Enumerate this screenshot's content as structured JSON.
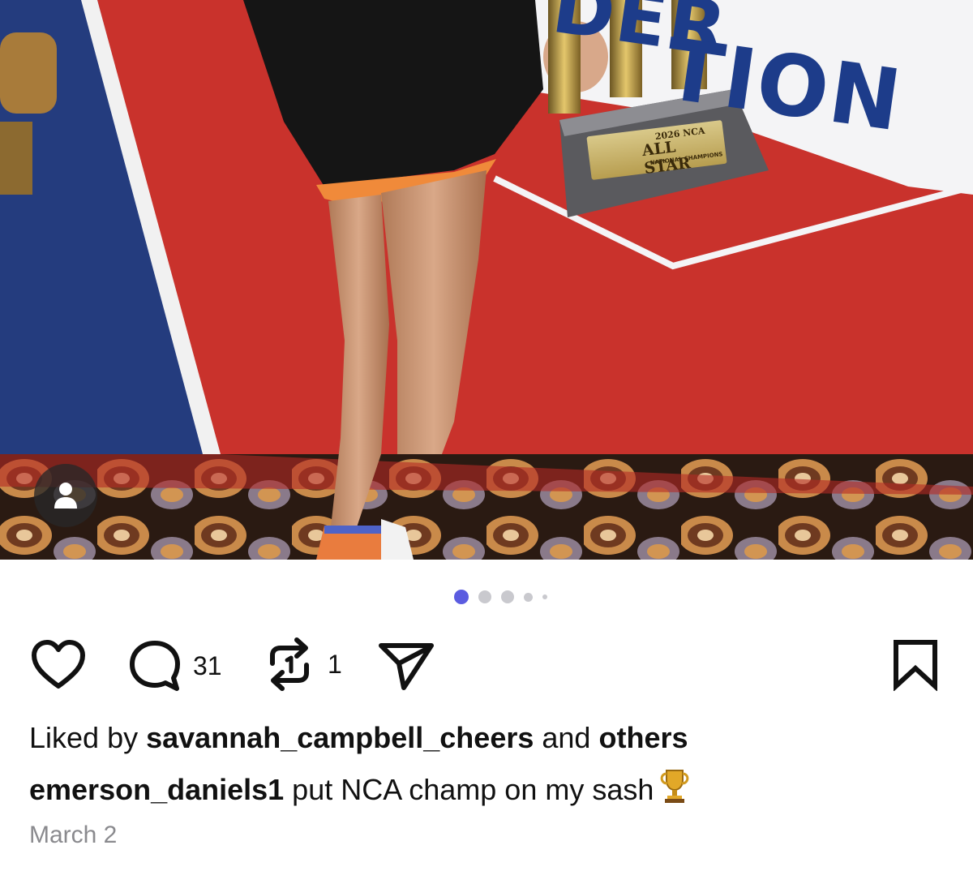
{
  "post": {
    "banner_top_text": "DER",
    "banner_mid_text": "TION",
    "plaque": {
      "line1": "2026 NCA",
      "line2": "ALL STAR",
      "line3": "NATIONAL CHAMPIONS"
    },
    "avatar_icon": "person-icon",
    "carousel": {
      "count": 5,
      "active_index": 0
    },
    "actions": {
      "like_icon": "heart-icon",
      "comment_icon": "comment-bubble-icon",
      "comment_count": "31",
      "repost_icon": "repost-icon",
      "repost_count": "1",
      "share_icon": "send-icon",
      "save_icon": "bookmark-icon"
    },
    "likes": {
      "prefix": "Liked by",
      "user": "savannah_campbell_cheers",
      "middle": "and",
      "suffix": "others"
    },
    "caption": {
      "username": "emerson_daniels1",
      "text": "put NCA champ on my sash",
      "emoji_icon": "trophy-icon"
    },
    "date": "March 2",
    "colors": {
      "accent": "#5b5ce0",
      "dot_inactive": "#c9c9ce",
      "text": "#111111",
      "muted": "#8a8a8e",
      "banner_red": "#c9322c",
      "banner_blue": "#1d3c8a"
    }
  }
}
